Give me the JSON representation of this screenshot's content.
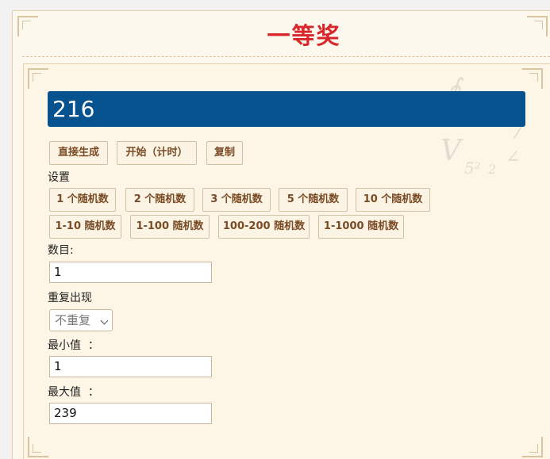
{
  "page": {
    "title": "一等奖"
  },
  "result": {
    "value": "216"
  },
  "actions": {
    "generate_label": "直接生成",
    "start_label": "开始（计时）",
    "copy_label": "复制"
  },
  "settings": {
    "heading": "设置",
    "presets_row1": [
      "1 个随机数",
      "2 个随机数",
      "3 个随机数",
      "5 个随机数",
      "10 个随机数"
    ],
    "presets_row2": [
      "1-10 随机数",
      "1-100 随机数",
      "100-200 随机数",
      "1-1000 随机数"
    ]
  },
  "form": {
    "count_label": "数目:",
    "count_value": "1",
    "repeat_label": "重复出现",
    "repeat_selected": "不重复",
    "min_label": "最小值  ：",
    "min_value": "1",
    "max_label": "最大值  ：",
    "max_value": "239"
  },
  "colors": {
    "title": "#d8262b",
    "result_bg": "#06528f",
    "button_text": "#7a4b25",
    "panel_bg": "#fdf5e6"
  }
}
